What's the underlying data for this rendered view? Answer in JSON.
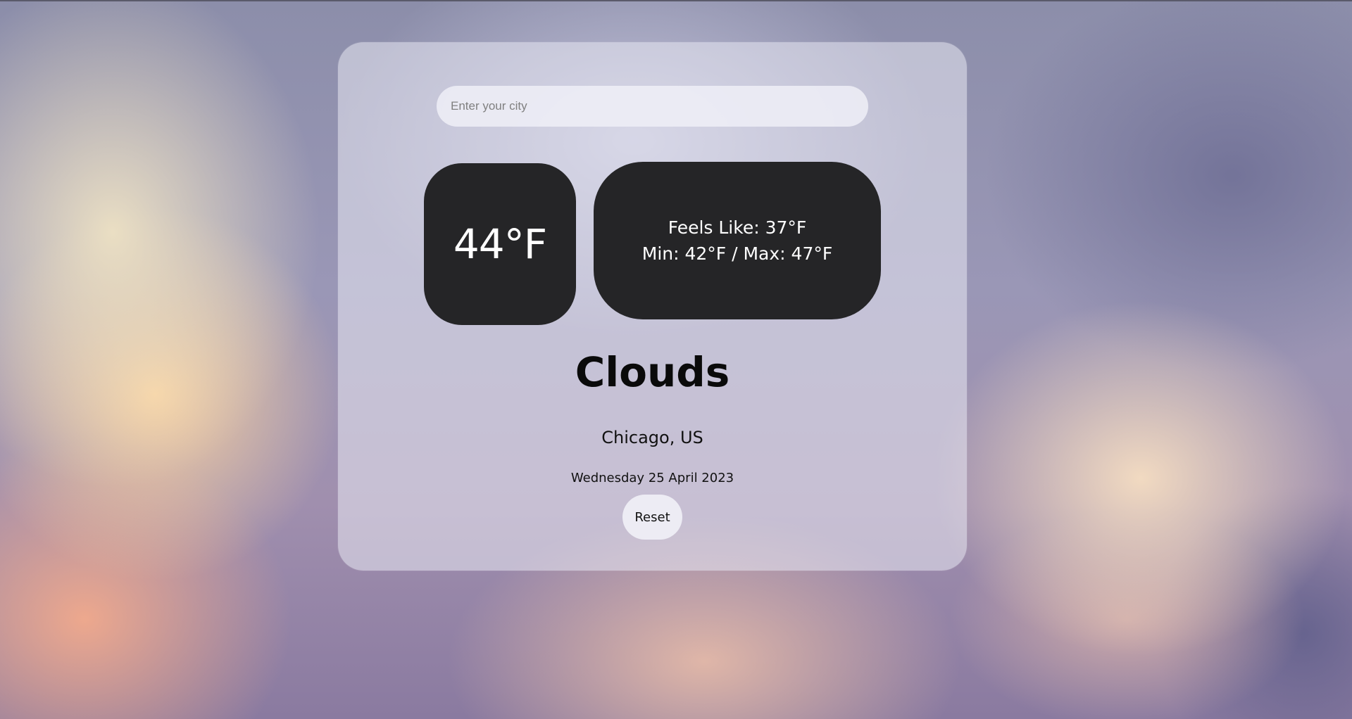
{
  "search": {
    "placeholder": "Enter your city",
    "value": ""
  },
  "weather": {
    "temperature": "44°F",
    "feels_like": "Feels Like: 37°F",
    "min_max": "Min: 42°F / Max: 47°F",
    "condition": "Clouds",
    "location": "Chicago, US",
    "date": "Wednesday 25 April 2023"
  },
  "actions": {
    "reset_label": "Reset"
  },
  "colors": {
    "panel_dark": "#252527",
    "text_light": "#ffffff",
    "text_dark": "#0a0a0a"
  }
}
